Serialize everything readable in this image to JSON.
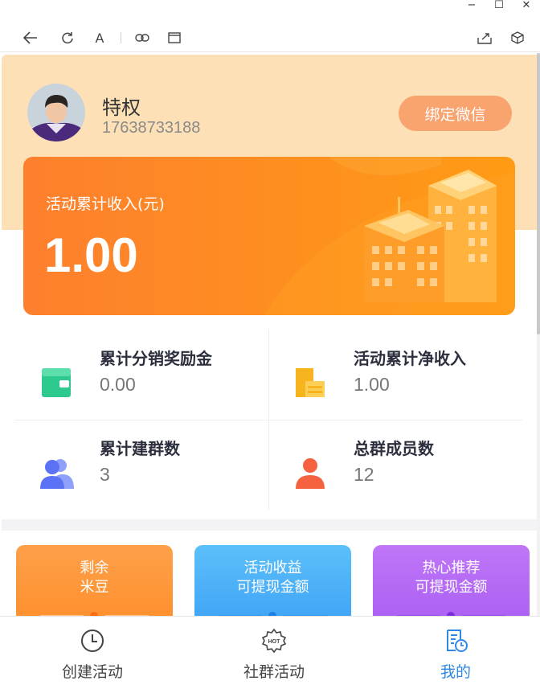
{
  "window": {
    "minimize": "−",
    "maximize": "☐",
    "close": "✕"
  },
  "toolbar": {
    "back_icon": "arrow-left-icon",
    "refresh_icon": "refresh-icon",
    "font_label": "A",
    "link_icon": "link-icon",
    "window_icon": "window-icon",
    "share_icon": "share-icon",
    "cube_icon": "cube-icon"
  },
  "profile": {
    "name": "特权",
    "phone": "17638733188",
    "bind_button": "绑定微信"
  },
  "income_card": {
    "label": "活动累计收入(元)",
    "value": "1.00"
  },
  "stats": [
    {
      "title": "累计分销奖励金",
      "value": "0.00",
      "icon": "wallet-icon",
      "color": "#2ec98f"
    },
    {
      "title": "活动累计净收入",
      "value": "1.00",
      "icon": "document-icon",
      "color": "#f8b41f"
    },
    {
      "title": "累计建群数",
      "value": "3",
      "icon": "group-icon",
      "color": "#5b72f6"
    },
    {
      "title": "总群成员数",
      "value": "12",
      "icon": "person-icon",
      "color": "#f4623f"
    }
  ],
  "feature_cards": [
    {
      "line1": "剩余",
      "line2": "米豆",
      "color": "#fea04a"
    },
    {
      "line1": "活动收益",
      "line2": "可提现金额",
      "color": "#50b3f8"
    },
    {
      "line1": "热心推荐",
      "line2": "可提现金额",
      "color": "#b369f5"
    }
  ],
  "tabs": [
    {
      "label": "创建活动",
      "icon": "clock-icon",
      "active": false
    },
    {
      "label": "社群活动",
      "icon": "hot-badge-icon",
      "active": false,
      "badge_text": "HOT"
    },
    {
      "label": "我的",
      "icon": "profile-doc-icon",
      "active": true
    }
  ],
  "colors": {
    "header_bg": "#fde0b6",
    "bind_button": "#f9a36f",
    "active_tab": "#2f88e8"
  }
}
